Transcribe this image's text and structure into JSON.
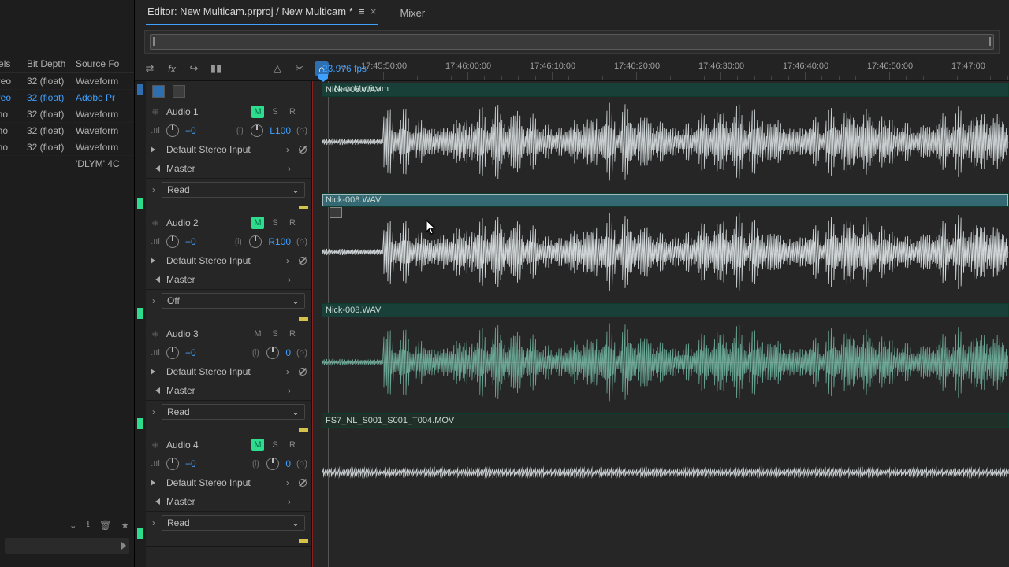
{
  "left": {
    "headers": [
      "annels",
      "Bit Depth",
      "Source Fo"
    ],
    "rows": [
      {
        "c": "ereo",
        "d": "32 (float)",
        "s": "Waveform"
      },
      {
        "c": "ereo",
        "d": "32 (float)",
        "s": "Adobe Pr",
        "sel": true
      },
      {
        "c": "ono",
        "d": "32 (float)",
        "s": "Waveform"
      },
      {
        "c": "ono",
        "d": "32 (float)",
        "s": "Waveform"
      },
      {
        "c": "ono",
        "d": "32 (float)",
        "s": "Waveform"
      },
      {
        "c": "",
        "d": "",
        "s": "'DLYM' 4C"
      }
    ]
  },
  "tabs": {
    "editor": "Editor: New Multicam.prproj / New Multicam *",
    "mixer": "Mixer"
  },
  "timecode": "23.976 fps",
  "ruler": [
    "17:45:50:00",
    "17:46:00:00",
    "17:46:10:00",
    "17:46:20:00",
    "17:46:30:00",
    "17:46:40:00",
    "17:46:50:00",
    "17:47:00"
  ],
  "seqname": "New Multicam",
  "tracks": [
    {
      "name": "Audio 1",
      "m": true,
      "s": "S",
      "r": "R",
      "vol": "+0",
      "pan": "L100",
      "input": "Default Stereo Input",
      "out": "Master",
      "auto": "Read",
      "clip": "Nick-008.WAV",
      "sel": false,
      "wave": "big",
      "color": "green"
    },
    {
      "name": "Audio 2",
      "m": true,
      "s": "S",
      "r": "R",
      "vol": "+0",
      "pan": "R100",
      "input": "Default Stereo Input",
      "out": "Master",
      "auto": "Off",
      "clip": "Nick-008.WAV",
      "sel": true,
      "wave": "big",
      "color": "green"
    },
    {
      "name": "Audio 3",
      "m": false,
      "s": "S",
      "r": "R",
      "vol": "+0",
      "pan": "0",
      "input": "Default Stereo Input",
      "out": "Master",
      "auto": "Read",
      "clip": "Nick-008.WAV",
      "sel": false,
      "wave": "big",
      "color": "muted"
    },
    {
      "name": "Audio 4",
      "m": true,
      "s": "S",
      "r": "R",
      "vol": "+0",
      "pan": "0",
      "input": "Default Stereo Input",
      "out": "Master",
      "auto": "Read",
      "clip": "FS7_NL_S001_S001_T004.MOV",
      "sel": false,
      "wave": "flat",
      "color": "green"
    }
  ],
  "labels": {
    "M": "M",
    "S": "S",
    "R": "R",
    "chev": "›",
    "chevd": "⌄"
  }
}
